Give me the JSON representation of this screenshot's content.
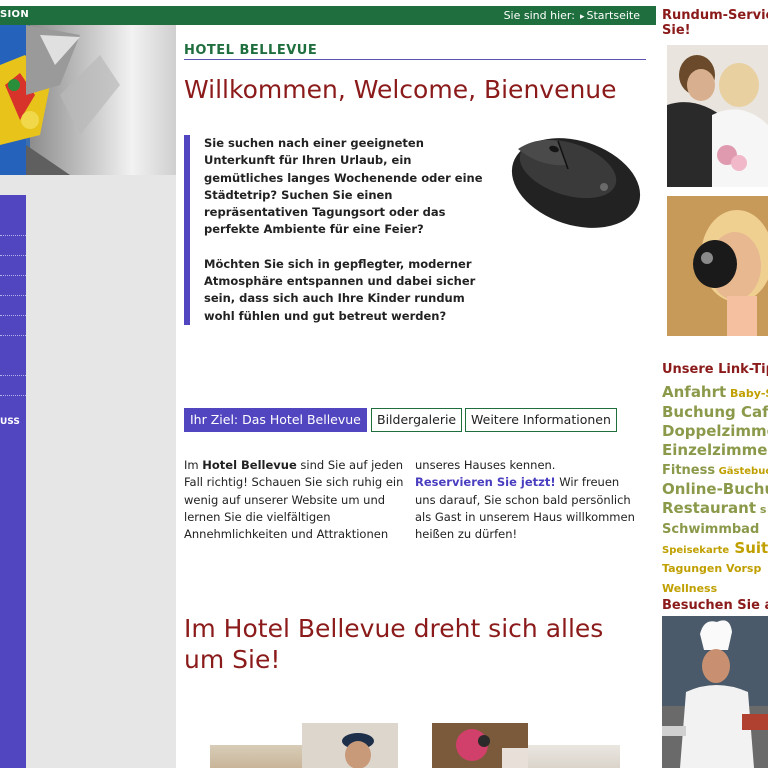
{
  "topbar": {
    "brand": "SION",
    "breadcrumb_prefix": "Sie sind hier:",
    "breadcrumb_link": "Startseite"
  },
  "left_nav": {
    "visible_label": "USS"
  },
  "main": {
    "hotel_name": "HOTEL BELLEVUE",
    "welcome": "Willkommen, Welcome, Bienvenue",
    "intro_paragraphs": [
      "Sie suchen nach einer geeigneten Unterkunft für Ihren Urlaub, ein gemütliches langes Wochenende oder eine Städtetrip? Suchen Sie einen repräsentativen Tagungsort oder das perfekte Ambiente für eine Feier?",
      "Möchten Sie sich in gepflegter, moderner Atmosphäre entspannen und dabei sicher sein, dass sich auch Ihre Kinder rundum wohl fühlen und gut betreut werden?"
    ],
    "tabs": [
      {
        "label": "Ihr Ziel: Das Hotel Bellevue",
        "active": true
      },
      {
        "label": "Bildergalerie",
        "active": false
      },
      {
        "label": "Weitere Informationen",
        "active": false
      }
    ],
    "col1": {
      "before": "Im ",
      "bold": "Hotel Bellevue",
      "after": " sind Sie auf jeden Fall richtig! Schauen Sie sich ruhig ein wenig auf unserer Website um und lernen Sie die vielfältigen Annehmlichkeiten und Attraktionen"
    },
    "col2": {
      "before": "unseres Hauses kennen.",
      "link": "Reservieren Sie jetzt!",
      "after": " Wir freuen uns darauf, Sie schon bald persönlich als Gast in unserem Haus willkommen heißen zu dürfen!"
    },
    "headline2": "Im Hotel Bellevue dreht sich alles um Sie!"
  },
  "right": {
    "service_heading_line1": "Rundum-Servic",
    "service_heading_line2": "Sie!",
    "links_heading": "Unsere Link-Tip",
    "tags": [
      [
        {
          "text": "Anfahrt",
          "size": "lg"
        },
        {
          "text": " Baby-S",
          "size": "sm"
        }
      ],
      [
        {
          "text": "Buchung",
          "size": "lg"
        },
        {
          "text": " Café",
          "size": "lg"
        }
      ],
      [
        {
          "text": "Doppelzimme",
          "size": "lg"
        }
      ],
      [
        {
          "text": "Einzelzimmer",
          "size": "lg"
        }
      ],
      [
        {
          "text": "Fitness",
          "size": "md"
        },
        {
          "text": " Gästebuc",
          "size": "xs"
        }
      ],
      [
        {
          "text": "Online-Buchu",
          "size": "lg"
        }
      ],
      [
        {
          "text": "Restaurant",
          "size": "lg"
        },
        {
          "text": " s",
          "size": "sm"
        }
      ],
      [
        {
          "text": "Schwimmbad",
          "size": "md"
        }
      ],
      [
        {
          "text": "Speisekarte",
          "size": "xs"
        },
        {
          "text": " Suite",
          "size": "lg"
        }
      ],
      [
        {
          "text": "Tagungen Vorsp",
          "size": "sm"
        }
      ],
      [
        {
          "text": "Wellness",
          "size": "sm"
        }
      ]
    ],
    "visit_heading": "Besuchen Sie a"
  }
}
